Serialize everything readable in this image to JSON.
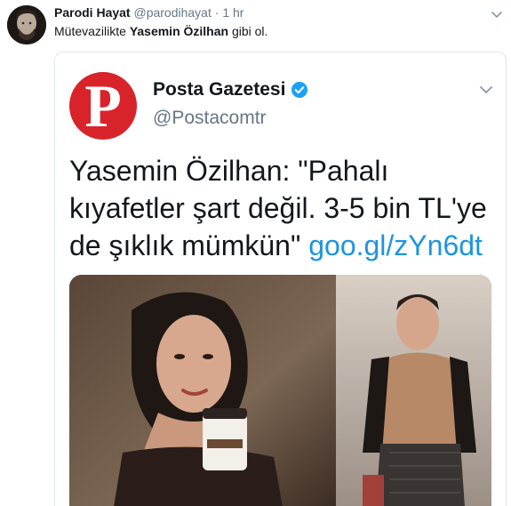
{
  "tweet": {
    "display_name": "Parodi Hayat",
    "handle": "@parodihayat",
    "separator": "·",
    "time": "1 hr",
    "text_before": "Mütevazilikte ",
    "text_bold": "Yasemin Özilhan",
    "text_after": " gibi ol.",
    "menu_icon": "chevron-down-icon",
    "avatar_icon": "avatar"
  },
  "quoted": {
    "logo_letter": "P",
    "display_name": "Posta Gazetesi",
    "handle": "@Postacomtr",
    "text_line1": "Yasemin Özilhan: \"Pahalı",
    "text_line2": "kıyafetler şart değil. 3-5 bin TL'ye",
    "text_line3": "de şıklık mümkün\" ",
    "link": "goo.gl/zYn6dt",
    "verified_icon": "verified-badge-icon",
    "menu_icon": "chevron-down-icon",
    "logo_color": "#d8232a",
    "link_color": "#1b95e0"
  }
}
